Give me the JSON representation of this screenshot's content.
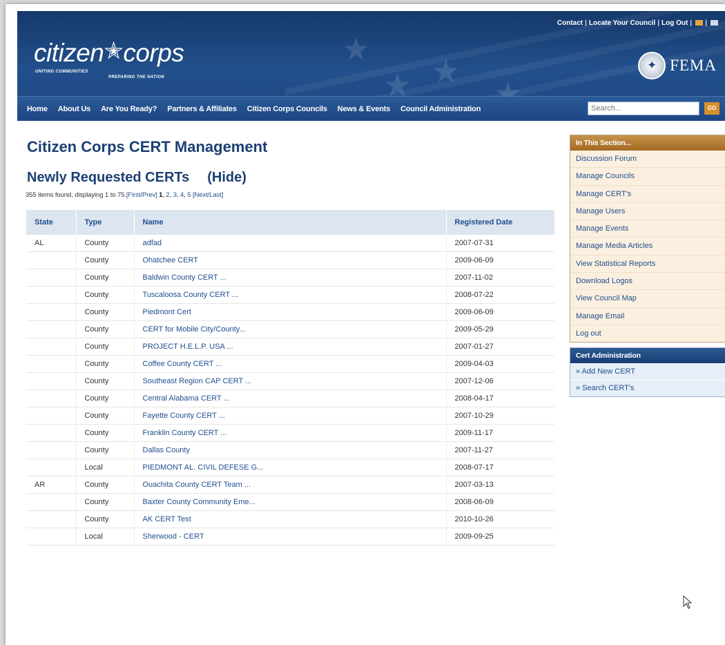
{
  "header": {
    "util_links": [
      "Contact",
      "Locate Your Council",
      "Log Out"
    ],
    "logo": {
      "left": "citizen",
      "right": "corps",
      "tagline1": "UNITING COMMUNITIES",
      "tagline2": "PREPARING THE NATION"
    },
    "agency": "FEMA"
  },
  "nav": {
    "items": [
      "Home",
      "About Us",
      "Are You Ready?",
      "Partners & Affiliates",
      "Citizen Corps Councils",
      "News & Events",
      "Council Administration"
    ],
    "search_placeholder": "Search...",
    "go_label": "GO"
  },
  "main": {
    "title": "Citizen Corps CERT Management",
    "section_title": "Newly Requested CERTs",
    "hide_label": "(Hide)",
    "pager": {
      "summary": "355 items found, displaying 1 to 75.",
      "first_prev": "[First/Prev]",
      "current": "1",
      "pages": [
        "2",
        "3",
        "4",
        "5"
      ],
      "next_last": "[Next/Last]"
    },
    "table": {
      "columns": [
        "State",
        "Type",
        "Name",
        "Registered Date"
      ],
      "rows": [
        {
          "state": "AL",
          "type": "County",
          "name": "adfad",
          "date": "2007-07-31"
        },
        {
          "state": "",
          "type": "County",
          "name": "Ohatchee CERT",
          "date": "2009-06-09"
        },
        {
          "state": "",
          "type": "County",
          "name": "Baldwin County CERT ...",
          "date": "2007-11-02"
        },
        {
          "state": "",
          "type": "County",
          "name": "Tuscaloosa County CERT ...",
          "date": "2008-07-22"
        },
        {
          "state": "",
          "type": "County",
          "name": "Piedmont Cert",
          "date": "2009-06-09"
        },
        {
          "state": "",
          "type": "County",
          "name": "CERT for Mobile City/County...",
          "date": "2009-05-29"
        },
        {
          "state": "",
          "type": "County",
          "name": "PROJECT H.E.L.P. USA ...",
          "date": "2007-01-27"
        },
        {
          "state": "",
          "type": "County",
          "name": "Coffee County CERT ...",
          "date": "2009-04-03"
        },
        {
          "state": "",
          "type": "County",
          "name": "Southeast Region CAP CERT ...",
          "date": "2007-12-06"
        },
        {
          "state": "",
          "type": "County",
          "name": "Central Alabama CERT ...",
          "date": "2008-04-17"
        },
        {
          "state": "",
          "type": "County",
          "name": "Fayette County CERT ...",
          "date": "2007-10-29"
        },
        {
          "state": "",
          "type": "County",
          "name": "Franklin County CERT ...",
          "date": "2009-11-17"
        },
        {
          "state": "",
          "type": "County",
          "name": "Dallas County",
          "date": "2007-11-27"
        },
        {
          "state": "",
          "type": "Local",
          "name": "PIEDMONT AL. CIVIL DEFESE G...",
          "date": "2008-07-17"
        },
        {
          "state": "AR",
          "type": "County",
          "name": "Ouachita County CERT Team ...",
          "date": "2007-03-13"
        },
        {
          "state": "",
          "type": "County",
          "name": "Baxter County Community Eme...",
          "date": "2008-06-09"
        },
        {
          "state": "",
          "type": "County",
          "name": "AK CERT Test",
          "date": "2010-10-26"
        },
        {
          "state": "",
          "type": "Local",
          "name": "Sherwood - CERT",
          "date": "2009-09-25"
        }
      ]
    }
  },
  "sidebar": {
    "section_title": "In This Section...",
    "section_items": [
      "Discussion Forum",
      "Manage Councils",
      "Manage CERT's",
      "Manage Users",
      "Manage Events",
      "Manage Media Articles",
      "View Statistical Reports",
      "Download Logos",
      "View Council Map",
      "Manage Email",
      "Log out"
    ],
    "admin_title": "Cert Administration",
    "admin_items": [
      "» Add New CERT",
      "» Search CERT's"
    ]
  },
  "colors": {
    "header_blue": "#1b4580",
    "link_blue": "#1f4d8f",
    "section_orange": "#a36a22",
    "go_orange": "#d8902c"
  }
}
